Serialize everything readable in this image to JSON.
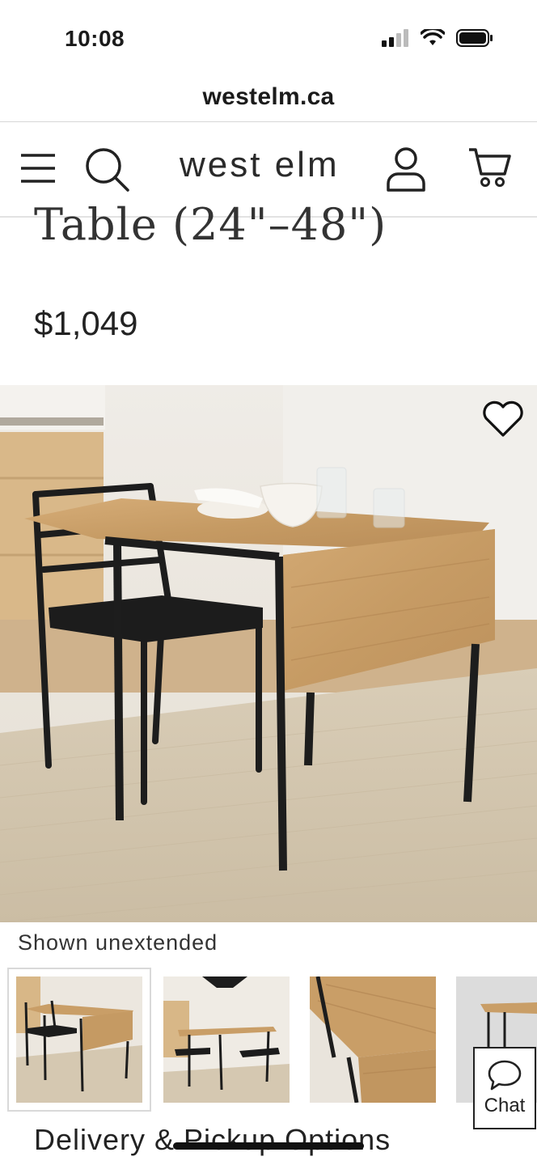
{
  "status_bar": {
    "time": "10:08"
  },
  "browser": {
    "url": "westelm.ca"
  },
  "header": {
    "brand": "west elm",
    "icons": [
      "menu-icon",
      "search-icon",
      "account-icon",
      "cart-icon"
    ]
  },
  "product": {
    "title_visible": "Table (24\"–48\")",
    "price": "$1,049",
    "image_caption": "Shown unextended",
    "thumbnail_count_visible": 4,
    "selected_thumbnail": 1
  },
  "chat": {
    "label": "Chat"
  },
  "sections": {
    "delivery_heading": "Delivery & Pickup Options"
  },
  "colors": {
    "text": "#1b1b1b",
    "wood": "#c9a06a",
    "metal": "#1d1d1d",
    "rug": "#d8cdb8"
  }
}
